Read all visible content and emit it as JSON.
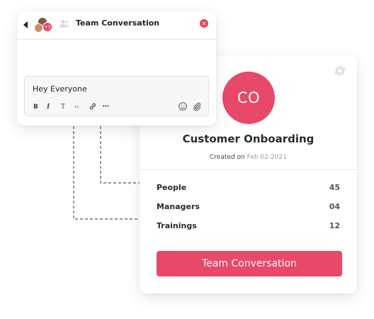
{
  "chat": {
    "title": "Team Conversation",
    "member_count": "+3",
    "message_input": "Hey Everyone",
    "toolbar": {
      "bold": "B",
      "italic": "I",
      "text": "T",
      "code": "‹›",
      "more": "•••"
    }
  },
  "card": {
    "avatar_initials": "CO",
    "title": "Customer Onboarding",
    "created_label": "Created on",
    "created_date": "Feb 02-2021",
    "stats": [
      {
        "label": "People",
        "value": "45"
      },
      {
        "label": "Managers",
        "value": "04"
      },
      {
        "label": "Trainings",
        "value": "12"
      }
    ],
    "cta_label": "Team Conversation"
  },
  "colors": {
    "accent": "#e8486a",
    "close": "#e24a57",
    "muted": "#9a9a9a"
  },
  "icons": [
    "back-arrow-icon",
    "people-icon",
    "close-icon",
    "gear-icon",
    "emoji-icon",
    "attachment-icon",
    "link-icon"
  ]
}
